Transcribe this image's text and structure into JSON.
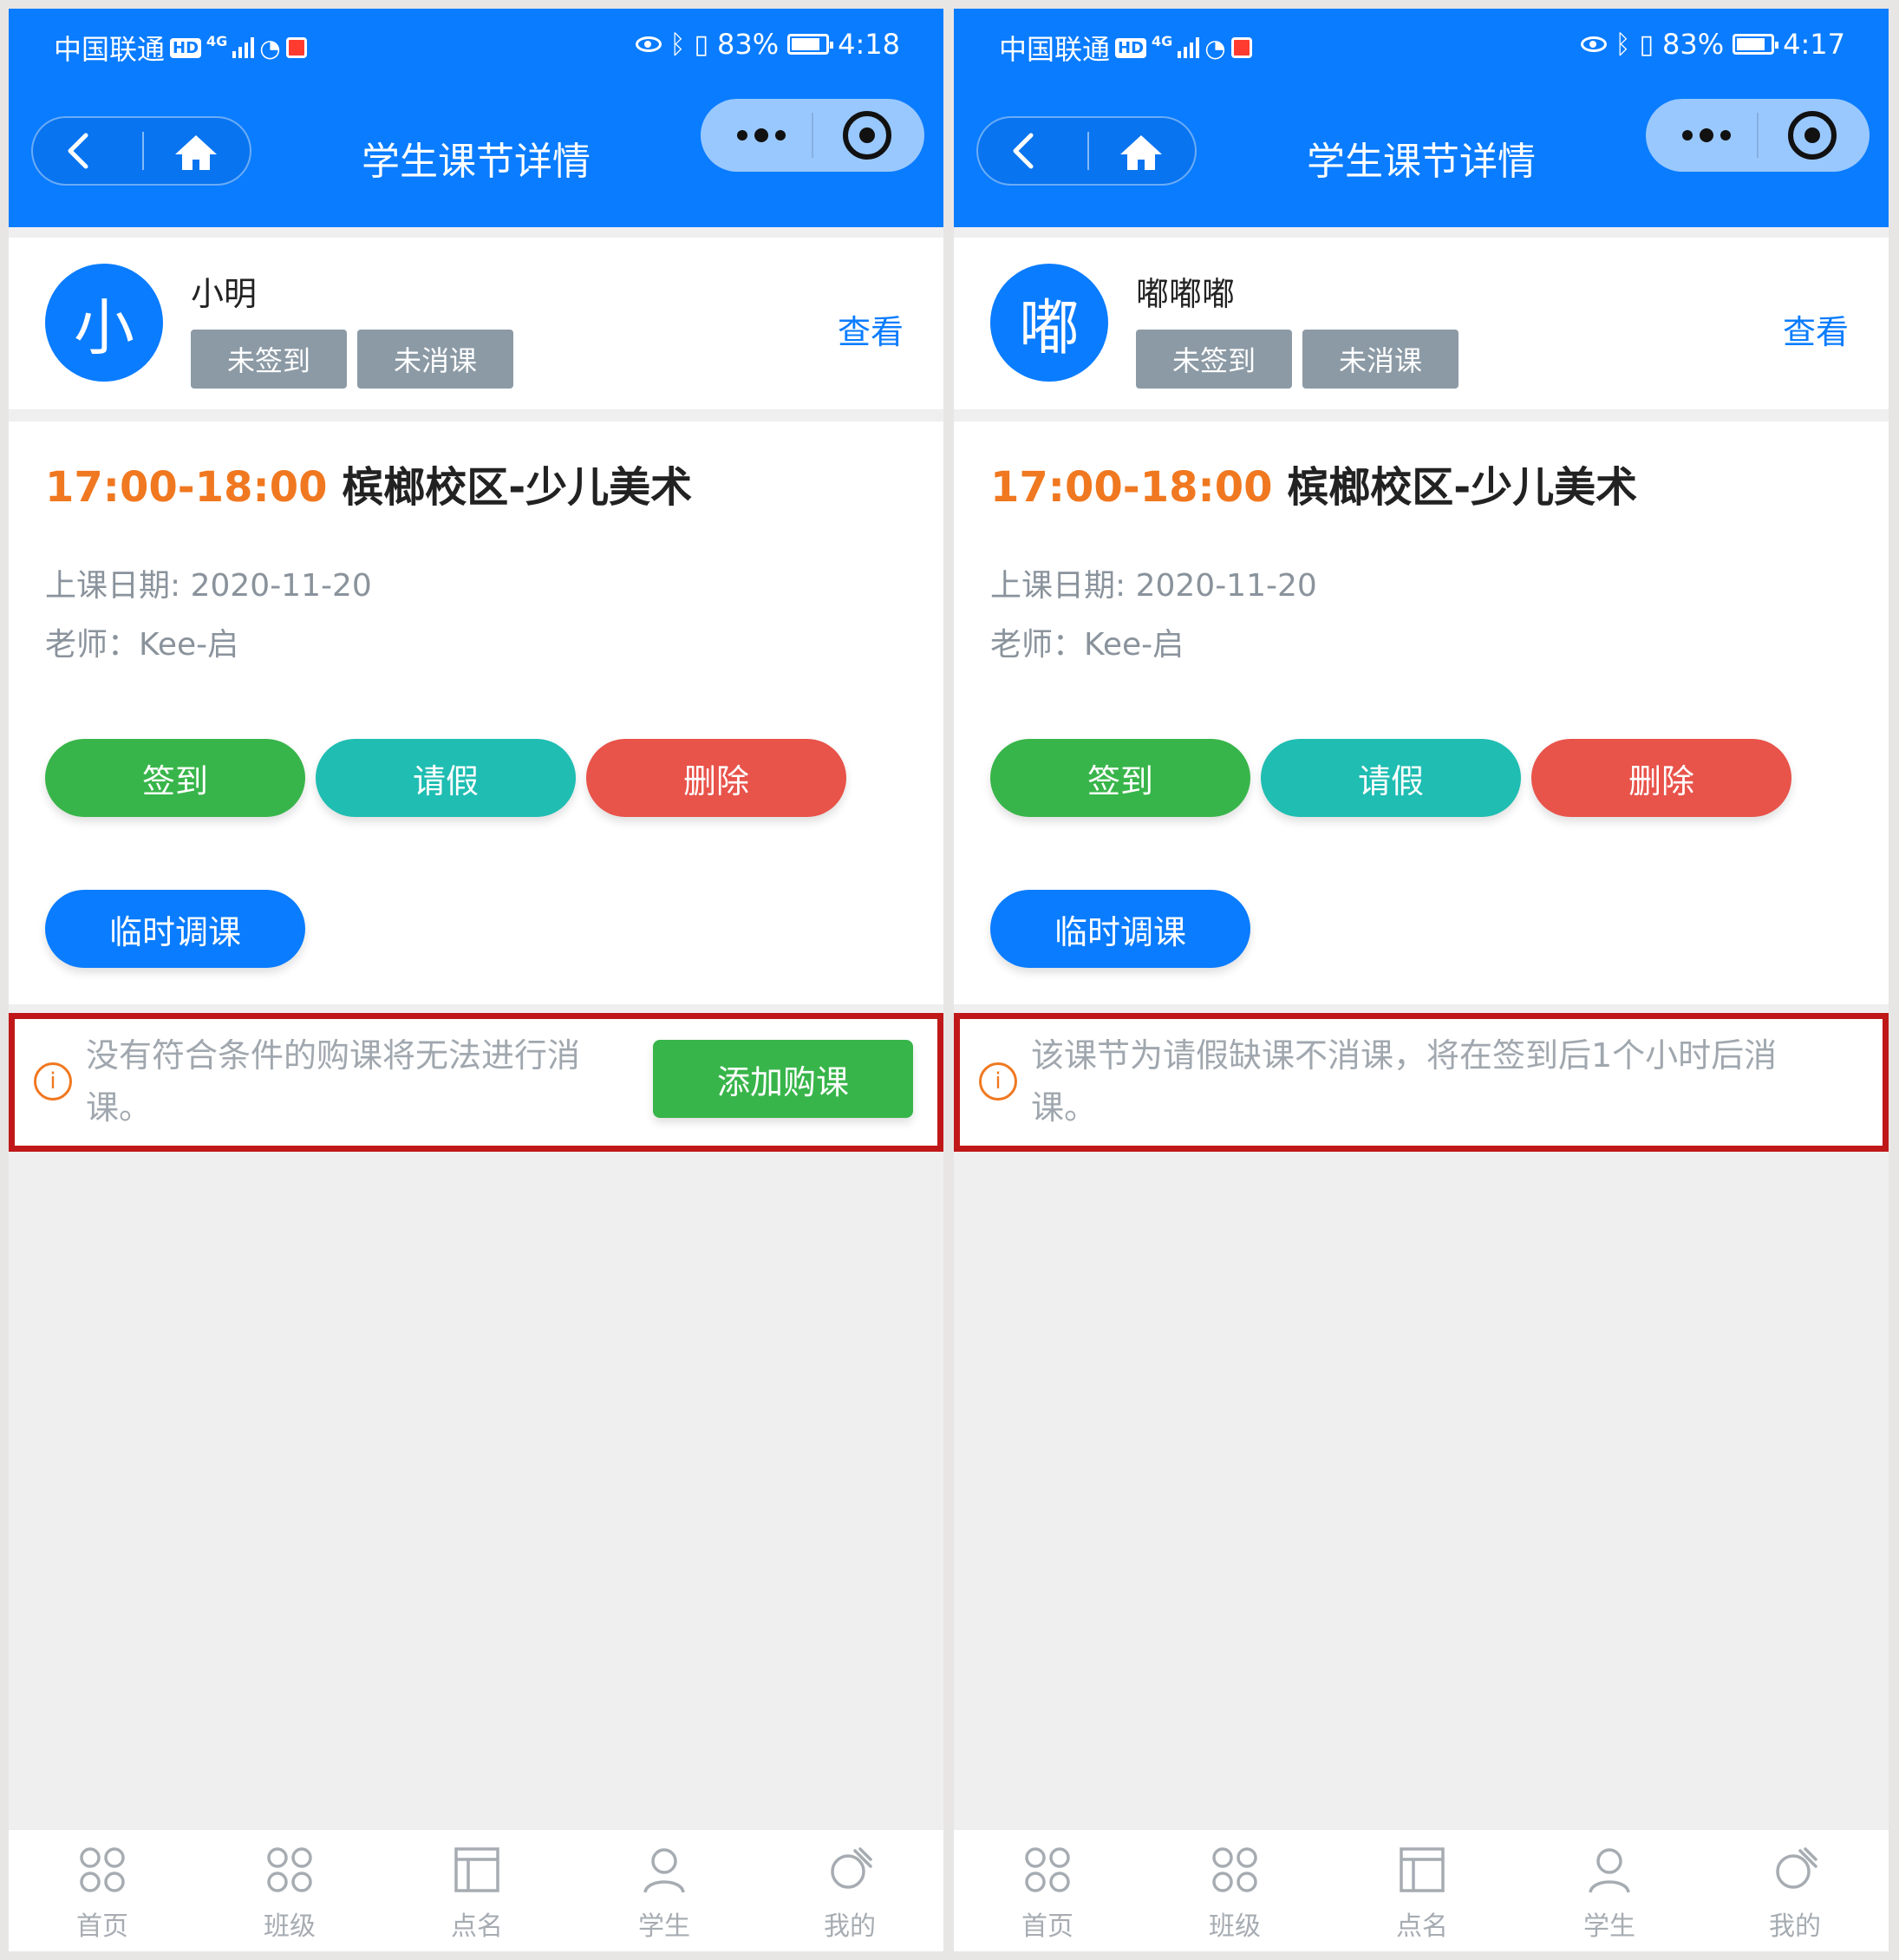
{
  "colors": {
    "brand": "#0a7cff",
    "orange": "#f07820",
    "green": "#38b54a",
    "teal": "#1fbdb2",
    "red": "#e8534a",
    "highlight_border": "#c01818",
    "tag_gray": "#8c9aa5"
  },
  "left": {
    "status": {
      "carrier": "中国联通",
      "hd": "HD",
      "network": "4G",
      "battery": "83%",
      "time": "4:18"
    },
    "page_title": "学生课节详情",
    "student": {
      "avatar_char": "小",
      "name": "小明",
      "tags": [
        "未签到",
        "未消课"
      ],
      "view_label": "查看"
    },
    "lesson": {
      "time": "17:00-18:00",
      "name": "槟榔校区-少儿美术",
      "date": "上课日期: 2020-11-20",
      "teacher": "老师：Kee-启"
    },
    "buttons": {
      "signin": "签到",
      "leave": "请假",
      "delete": "删除",
      "reschedule": "临时调课"
    },
    "notice": {
      "text": "没有符合条件的购课将无法进行消课。",
      "action": "添加购课"
    },
    "tabs": [
      "首页",
      "班级",
      "点名",
      "学生",
      "我的"
    ]
  },
  "right": {
    "status": {
      "carrier": "中国联通",
      "hd": "HD",
      "network": "4G",
      "battery": "83%",
      "time": "4:17"
    },
    "page_title": "学生课节详情",
    "student": {
      "avatar_char": "嘟",
      "name": "嘟嘟嘟",
      "tags": [
        "未签到",
        "未消课"
      ],
      "view_label": "查看"
    },
    "lesson": {
      "time": "17:00-18:00",
      "name": "槟榔校区-少儿美术",
      "date": "上课日期: 2020-11-20",
      "teacher": "老师：Kee-启"
    },
    "buttons": {
      "signin": "签到",
      "leave": "请假",
      "delete": "删除",
      "reschedule": "临时调课"
    },
    "notice": {
      "text": "该课节为请假缺课不消课，将在签到后1个小时后消课。"
    },
    "tabs": [
      "首页",
      "班级",
      "点名",
      "学生",
      "我的"
    ]
  }
}
